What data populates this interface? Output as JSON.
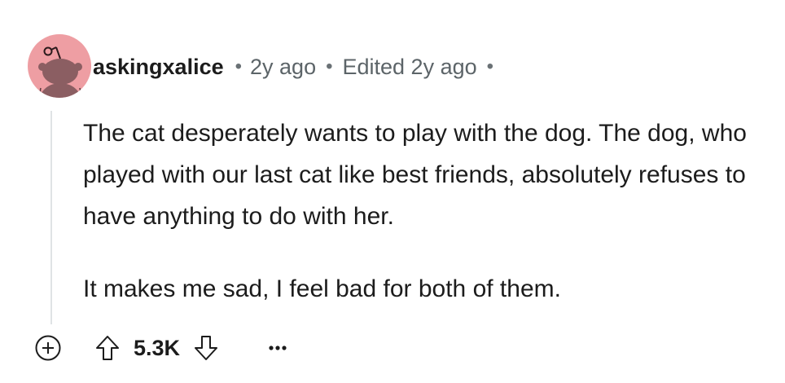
{
  "comment": {
    "username": "askingxalice",
    "age": "2y ago",
    "edited": "Edited 2y ago",
    "separator": "•",
    "paragraphs": [
      "The cat desperately wants to play with the dog. The dog, who played with our last cat like best friends, absolutely refuses to have anything to do with her.",
      "It makes me sad, I feel bad for both of them."
    ],
    "score": "5.3K"
  },
  "icons": {
    "avatar": "snoo-avatar-icon",
    "expand": "add-circle-icon",
    "upvote": "upvote-arrow-icon",
    "downvote": "downvote-arrow-icon",
    "more": "more-options-icon"
  },
  "colors": {
    "avatar_bg": "#ee9ea3",
    "text": "#1c1c1c",
    "meta": "#5c6468",
    "thread_line": "#dfe3e5"
  }
}
